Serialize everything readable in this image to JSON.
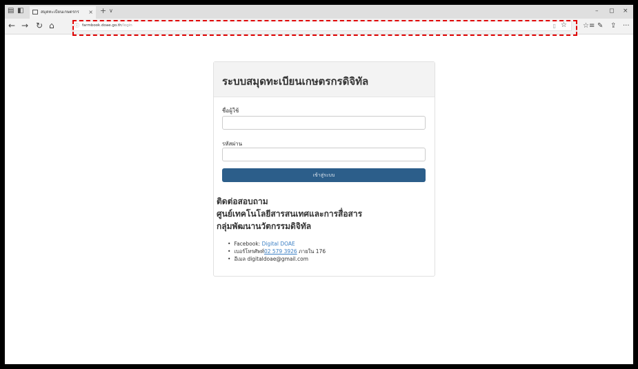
{
  "browser": {
    "tab": {
      "title": "สมุดทะเบียนเกษตรกร",
      "close": "×"
    },
    "new_tab": "+",
    "tab_menu": "∨",
    "window_controls": {
      "minimize": "–",
      "restore": "◻",
      "close": "×"
    },
    "nav": {
      "back": "←",
      "forward": "→",
      "refresh": "↻",
      "home": "⌂"
    },
    "address": {
      "info_icon": "ⓘ",
      "host": "farmbook.doae.go.th",
      "path": "/login",
      "reading_icon": "▯",
      "favorite_icon": "☆"
    },
    "toolbar_icons": {
      "favorites": "☆≡",
      "notes": "✎",
      "share": "⇪",
      "more": "···"
    }
  },
  "page": {
    "title": "ระบบสมุดทะเบียนเกษตรกรดิจิทัล",
    "username_label": "ชื่อผู้ใช้",
    "username_value": "",
    "password_label": "รหัสผ่าน",
    "password_value": "",
    "login_button": "เข้าสู่ระบบ",
    "contact": {
      "heading_lines": [
        "ติดต่อสอบถาม",
        "ศูนย์เทคโนโลยีสารสนเทศและการสื่อสาร",
        "กลุ่มพัฒนานวัตกรรมดิจิทัล"
      ],
      "facebook_label": "Facebook:",
      "facebook_link": "Digital DOAE",
      "phone_label": "เบอร์โทรศัพท์",
      "phone_number": "02 579 3926",
      "phone_ext": "ภายใน 176",
      "email_label": "อีเมล",
      "email": "digitaldoae@gmail.com"
    }
  },
  "colors": {
    "highlight_border": "#e00000",
    "login_button": "#2c5e8a",
    "link": "#3b7fc4"
  }
}
